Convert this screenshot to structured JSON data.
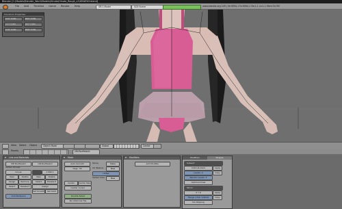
{
  "window": {
    "title": "Blender [C:\\Models\\Blender_Work\\Models\\Hinata\\Hinata_Rough_v2\\HINATA3.blend]"
  },
  "menubar": {
    "items": [
      "File",
      "Add",
      "Timeline",
      "Game",
      "Render",
      "Help"
    ],
    "screen_field": "SR:2-Model",
    "scene_field": "SCE:Scene",
    "status": "www.blender.org 249 | Ve:9094-1 Fa:9094-1 Ob:1-1 La:1-1 Mem:34.5M"
  },
  "float_panel": {
    "title": "Transform Properties",
    "fields": [
      "LocX: 0.000",
      "RotX: 0.000",
      "LocY: 0.000",
      "RotY: 0.000",
      "LocZ: 0.000",
      "RotZ: 0.000"
    ]
  },
  "viewport_header": {
    "view": "View",
    "select": "Select",
    "object": "Object",
    "mode": "Object Mode",
    "pivot": "Global",
    "layer": "Center"
  },
  "buttons_header": {
    "panels": "Panels",
    "object_label": "OB:Pouffeskirt"
  },
  "link_panel": {
    "title": "Link and Materials",
    "me_field": "ME:Pouffeskirt",
    "ob_field": "OB:Pouffeskirt",
    "vertex_groups": "Vertex Groups",
    "group_field": "Group",
    "new": "New",
    "delete": "Delete",
    "assign": "Assign",
    "remove": "Remove",
    "select": "Select",
    "deselect": "Deselect",
    "set_smooth": "Set Smooth",
    "set_solid": "Set Solid",
    "auto_smooth": "AutoTexSpace",
    "mat_label": "1 Mat 1"
  },
  "mesh_panel": {
    "title": "Mesh",
    "auto_smooth": "Auto Smooth",
    "degr": "Degr: 30",
    "sticky": "Sticky",
    "make": "Make",
    "uv_texture": "UV Texture",
    "new": "New",
    "uv_name": "UVTex",
    "vertex_color": "Vertex Color",
    "new2": "New",
    "center": "Center",
    "center_new": "Center New",
    "center_cursor": "Center Cursor",
    "double_sided": "Double Sided",
    "no_v_normal_flip": "No V.Normal Flip",
    "tex_mesh": "TexMesh"
  },
  "modifiers_panel": {
    "title": "Modifiers",
    "add_modifier": "Add Modifier"
  },
  "right_panel": {
    "tab_modifiers": "Modifiers",
    "tab_shapes": "Shapes",
    "subsurf_title": "Subsurf",
    "mirror_title": "Mirror",
    "catmull": "Catmull-Clark",
    "levels": "Levels: 2",
    "render_levels": "Render Levels: 2",
    "optimal_draw": "Optimal Draw",
    "apply": "Apply",
    "copy": "Copy",
    "axis": "X  Y  Z",
    "merge_limit": "Merge Limit: 0.0010",
    "do_clipping": "Do Clipping",
    "mirror_u": "Mirror U",
    "mirror_v": "Mirror V"
  }
}
